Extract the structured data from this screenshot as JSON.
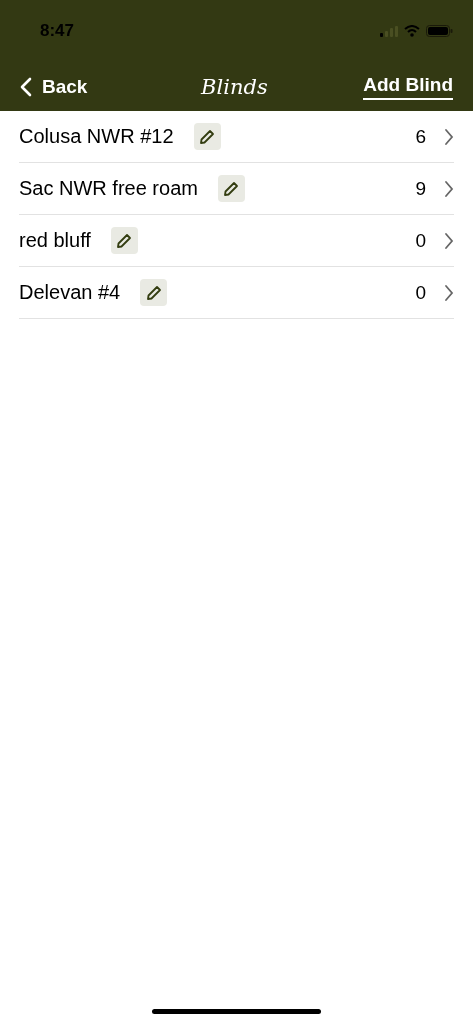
{
  "status_bar": {
    "time": "8:47"
  },
  "nav_bar": {
    "back": "Back",
    "title": "Blinds",
    "action": "Add Blind"
  },
  "blinds": [
    {
      "name": "Colusa NWR #12",
      "count": "6"
    },
    {
      "name": "Sac NWR free roam",
      "count": "9"
    },
    {
      "name": "red bluff",
      "count": "0"
    },
    {
      "name": "Delevan #4",
      "count": "0"
    }
  ]
}
